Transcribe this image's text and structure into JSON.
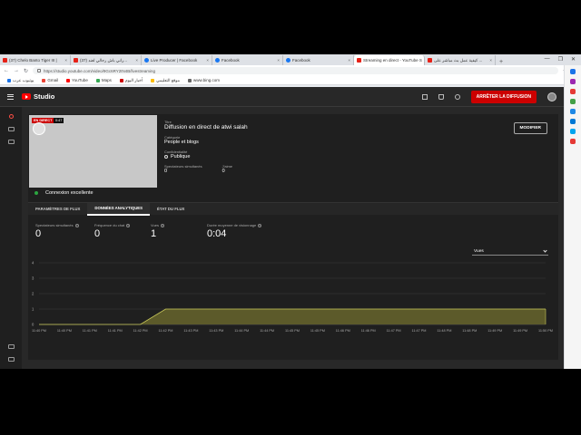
{
  "browser": {
    "tabs": [
      {
        "label": "(37) Chelo Banto Tiger III |",
        "icon": "youtube",
        "active": false
      },
      {
        "label": "(37) راني باش رحالي لعند...",
        "icon": "youtube",
        "active": false
      },
      {
        "label": "Live Producer | Facebook",
        "icon": "facebook",
        "active": false
      },
      {
        "label": "Facebook",
        "icon": "facebook",
        "active": false
      },
      {
        "label": "Facebook",
        "icon": "facebook",
        "active": false
      },
      {
        "label": "Streaming en direct - YouTube S",
        "icon": "youtube",
        "active": true
      },
      {
        "label": "كيفية عمل بث مباشر على ...",
        "icon": "youtube",
        "active": false
      }
    ],
    "new_tab": "+",
    "window_controls": [
      "—",
      "❐",
      "✕"
    ],
    "url": "https://studio.youtube.com/video/9Gc6RY2tN4B/livestreaming",
    "bookmarks": [
      {
        "label": "يوتيوب عرب",
        "color": "#1a73e8"
      },
      {
        "label": "Gmail",
        "color": "#ea4335"
      },
      {
        "label": "YouTube",
        "color": "#ff0000"
      },
      {
        "label": "Maps",
        "color": "#34a853"
      },
      {
        "label": "أخبار اليوم",
        "color": "#cc0000"
      },
      {
        "label": "موقع التعليمي",
        "color": "#fbbc04"
      },
      {
        "label": "www.bing.com",
        "color": "#666666"
      }
    ]
  },
  "studio": {
    "logo_text": "Studio",
    "end_stream_label": "ARRÊTER LA DIFFUSION",
    "preview": {
      "live_badge": "EN DIRECT",
      "time_badge": "0:47"
    },
    "details": {
      "title_label": "Titre",
      "title_value": "Diffusion en direct de atwi salah",
      "category_label": "Catégorie",
      "category_value": "People et blogs",
      "visibility_label": "Confidentialité",
      "visibility_value": "Publique",
      "viewers_label": "Spectateurs simultanés",
      "viewers_value": "0",
      "likes_label": "J'aime",
      "likes_value": "0"
    },
    "modify_label": "MODIFIER",
    "connection_status": "Connexion excellente",
    "tabs": [
      "PARAMÈTRES DE FLUX",
      "DONNÉES ANALYTIQUES",
      "ÉTAT DU FLUX"
    ],
    "active_tab": 1,
    "metrics": [
      {
        "label": "Spectateurs simultanés",
        "value": "0"
      },
      {
        "label": "Fréquence du chat",
        "value": "0"
      },
      {
        "label": "Vues",
        "value": "1"
      },
      {
        "label": "Durée moyenne de visionnage",
        "value": "0:04"
      }
    ],
    "metric_select": "Vues"
  },
  "chart_data": {
    "type": "area",
    "x": [
      "11:40 PM",
      "11:40 PM",
      "11:41 PM",
      "11:41 PM",
      "11:42 PM",
      "11:42 PM",
      "11:43 PM",
      "11:43 PM",
      "11:44 PM",
      "11:44 PM",
      "11:45 PM",
      "11:45 PM",
      "11:46 PM",
      "11:46 PM",
      "11:47 PM",
      "11:47 PM",
      "11:48 PM",
      "11:48 PM",
      "11:49 PM",
      "11:49 PM"
    ],
    "x_tick_labels": [
      "11:40 PM",
      "11:40 PM",
      "11:41 PM",
      "11:41 PM",
      "11:42 PM",
      "11:42 PM",
      "11:43 PM",
      "11:43 PM",
      "11:44 PM",
      "11:44 PM",
      "11:45 PM",
      "11:45 PM",
      "11:46 PM",
      "11:46 PM",
      "11:47 PM",
      "11:47 PM",
      "11:48 PM",
      "11:48 PM",
      "11:49 PM",
      "11:49 PM",
      "11:50 PM"
    ],
    "series": [
      {
        "values": [
          0,
          0,
          0,
          0,
          0,
          1,
          1,
          1,
          1,
          1,
          1,
          1,
          1,
          1,
          1,
          1,
          1,
          1,
          1,
          1,
          1
        ],
        "color": "#c9c95a"
      }
    ],
    "ylim": [
      0,
      4
    ],
    "y_ticks": [
      0,
      1,
      2,
      3,
      4
    ],
    "grid": true,
    "xlabel": "",
    "ylabel": ""
  }
}
